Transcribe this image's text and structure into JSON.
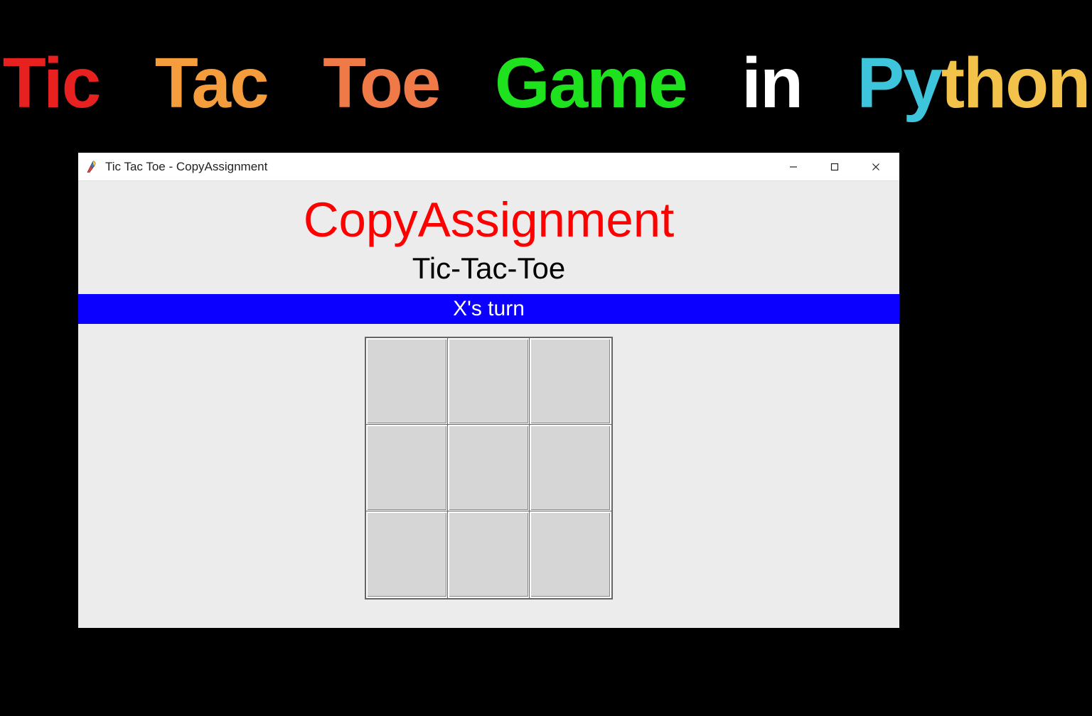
{
  "banner": {
    "tic": "Tic",
    "tac": "Tac",
    "toe": "Toe",
    "game": "Game",
    "in": "in",
    "python_py": "Py",
    "python_thon": "thon"
  },
  "window": {
    "title": "Tic Tac Toe - CopyAssignment"
  },
  "app": {
    "brand": "CopyAssignment",
    "game_title": "Tic-Tac-Toe",
    "turn_text": "X's turn",
    "board": [
      [
        "",
        "",
        ""
      ],
      [
        "",
        "",
        ""
      ],
      [
        "",
        "",
        ""
      ]
    ]
  },
  "colors": {
    "banner_tic": "#e7211f",
    "banner_tac": "#f59d3d",
    "banner_toe": "#f07948",
    "banner_game": "#1de21d",
    "banner_in": "#ffffff",
    "banner_python_cyan": "#3fc5db",
    "banner_python_yellow": "#f2c24a",
    "brand_heading": "#ff0000",
    "turn_banner_bg": "#0b00ff",
    "turn_banner_fg": "#ffffff"
  }
}
